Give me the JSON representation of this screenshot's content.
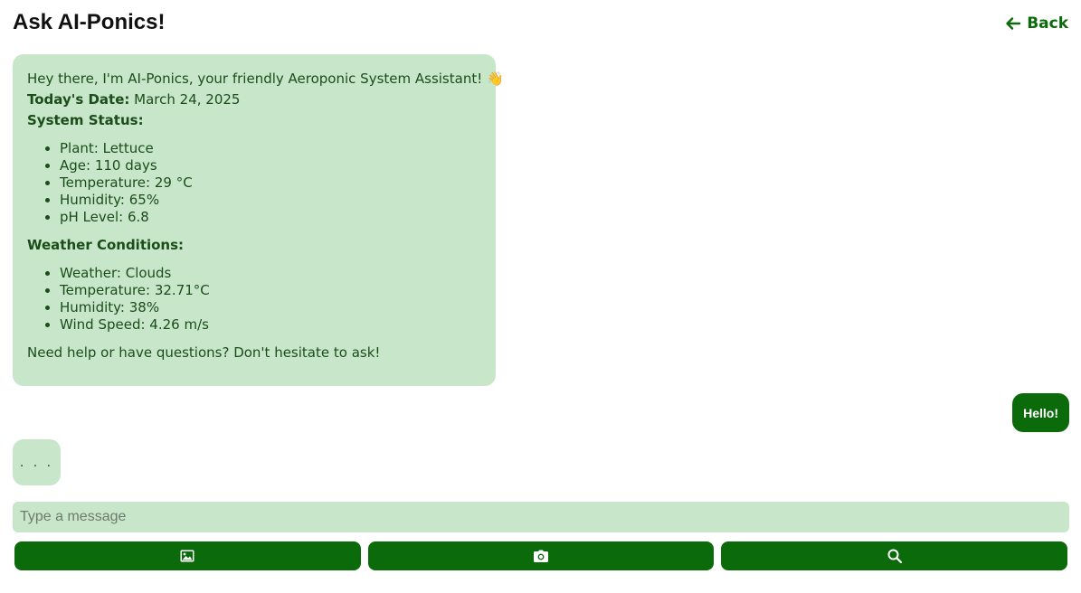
{
  "header": {
    "title": "Ask AI-Ponics!",
    "back_label": "Back",
    "back_icon": "arrow-left-icon"
  },
  "bot_message": {
    "greeting": "Hey there, I'm AI-Ponics, your friendly Aeroponic System Assistant! 👋",
    "date_label": "Today's Date:",
    "date_value": " March 24, 2025",
    "system_status_heading": "System Status:",
    "system_status": [
      "Plant: Lettuce",
      "Age: 110 days",
      "Temperature: 29 °C",
      "Humidity: 65%",
      "pH Level: 6.8"
    ],
    "weather_heading": "Weather Conditions:",
    "weather": [
      "Weather: Clouds",
      "Temperature: 32.71°C",
      "Humidity: 38%",
      "Wind Speed: 4.26 m/s"
    ],
    "outro": "Need help or have questions? Don't hesitate to ask!"
  },
  "user_message": {
    "text": "Hello!"
  },
  "typing_indicator": {
    "text": ". . ."
  },
  "composer": {
    "placeholder": "Type a message",
    "value": ""
  },
  "actions": [
    {
      "icon": "image-icon"
    },
    {
      "icon": "camera-icon"
    },
    {
      "icon": "search-icon"
    }
  ],
  "colors": {
    "accent": "#0b6b0b",
    "bubble": "#c8e6c9",
    "bubble_text": "#1b4d1b"
  }
}
